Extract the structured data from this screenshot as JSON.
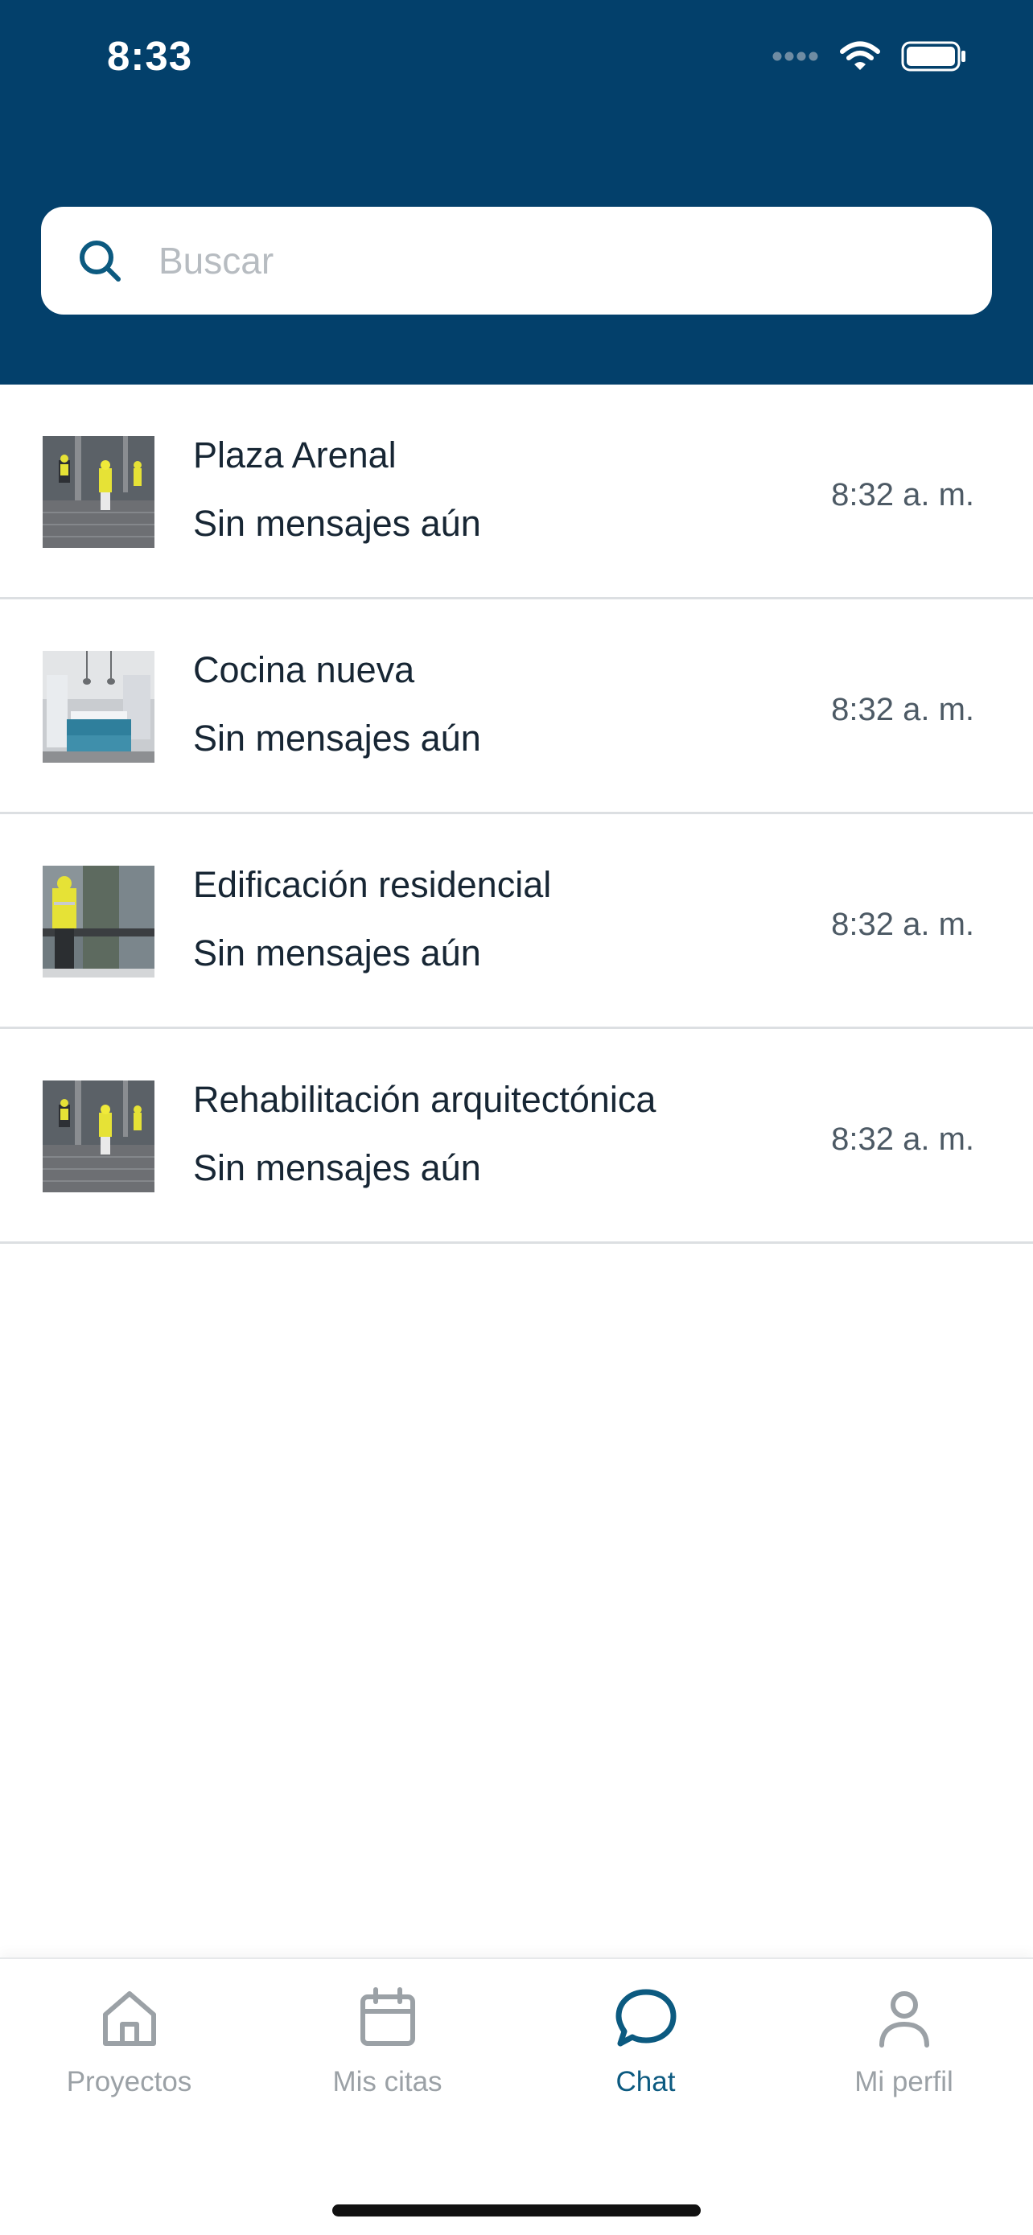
{
  "status_bar": {
    "time": "8:33",
    "icons": [
      "signal-dots-icon",
      "wifi-icon",
      "battery-icon"
    ]
  },
  "search": {
    "placeholder": "Buscar",
    "value": ""
  },
  "chats": [
    {
      "name": "Plaza Arenal",
      "preview": "Sin mensajes aún",
      "time": "8:32 a. m.",
      "thumbnail": "construction-workers-site"
    },
    {
      "name": "Cocina nueva",
      "preview": "Sin mensajes aún",
      "time": "8:32 a. m.",
      "thumbnail": "kitchen-interior"
    },
    {
      "name": "Edificación residencial",
      "preview": "Sin mensajes aún",
      "time": "8:32 a. m.",
      "thumbnail": "worker-with-column"
    },
    {
      "name": "Rehabilitación arquitectónica",
      "preview": "Sin mensajes aún",
      "time": "8:32 a. m.",
      "thumbnail": "construction-workers-site"
    }
  ],
  "tabbar": {
    "tabs": [
      {
        "label": "Proyectos",
        "icon": "home-icon",
        "active": false
      },
      {
        "label": "Mis citas",
        "icon": "calendar-icon",
        "active": false
      },
      {
        "label": "Chat",
        "icon": "chat-bubble-icon",
        "active": true
      },
      {
        "label": "Mi perfil",
        "icon": "person-icon",
        "active": false
      }
    ]
  },
  "colors": {
    "header_bg": "#03406b",
    "accent": "#0c5a80",
    "inactive_tab": "#9ba1a6",
    "divider": "#dcdfe2"
  }
}
